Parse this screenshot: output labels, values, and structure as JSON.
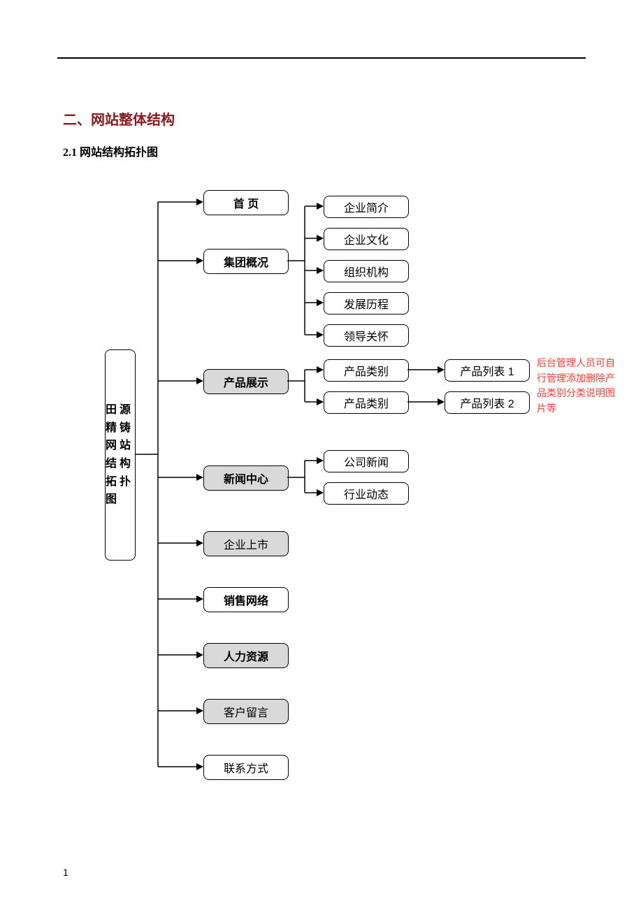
{
  "title": "二、网站整体结构",
  "subtitle": "2.1 网站结构拓扑图",
  "pagenum": "1",
  "root": "田源精铸网站结构拓扑图",
  "l2": {
    "home": "首  页",
    "about": "集团概况",
    "prod": "产品展示",
    "news": "新闻中心",
    "ipo": "企业上市",
    "sales": "销售网络",
    "hr": "人力资源",
    "guest": "客户留言",
    "contact": "联系方式"
  },
  "about_sub": [
    "企业简介",
    "企业文化",
    "组织机构",
    "发展历程",
    "领导关怀"
  ],
  "prod_sub": [
    "产品类别",
    "产品类别"
  ],
  "prod_leaf": [
    "产品列表 1",
    "产品列表 2"
  ],
  "news_sub": [
    "公司新闻",
    "行业动态"
  ],
  "note": "后台管理人员可自行管理添加删除产品类别分类说明图片等"
}
